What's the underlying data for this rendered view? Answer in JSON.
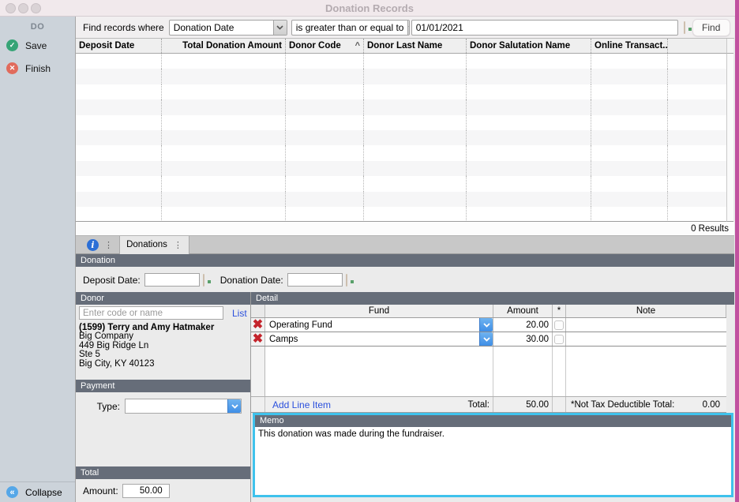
{
  "window": {
    "title": "Donation Records"
  },
  "colors": {
    "section_header": "#666d79",
    "accent_blue": "#3f8ee6",
    "link_blue": "#2b50dd",
    "save_green": "#36a476",
    "finish_red": "#e16b5c",
    "memo_highlight": "#3fc2ec",
    "window_edge_magenta": "#c0519f",
    "sidebar_bg": "#ccd3da"
  },
  "sidebar": {
    "header": "DO",
    "save_label": "Save",
    "finish_label": "Finish",
    "collapse_label": "Collapse"
  },
  "search": {
    "label": "Find records where",
    "field_selected": "Donation Date",
    "operator_selected": "is greater than or equal to",
    "value": "01/01/2021",
    "find_button": "Find"
  },
  "results_table": {
    "columns": [
      "Deposit Date",
      "Total Donation Amount",
      "Donor Code",
      "Donor Last Name",
      "Donor Salutation Name",
      "Online Transact..."
    ],
    "sorted_column": "Donor Code",
    "sort_indicator": "^",
    "empty_row_count": 11,
    "results_text": "0 Results"
  },
  "tabs": {
    "active_tab": "Donations"
  },
  "donation": {
    "section_title": "Donation",
    "deposit_date_label": "Deposit Date:",
    "deposit_date_value": "",
    "donation_date_label": "Donation Date:",
    "donation_date_value": ""
  },
  "donor": {
    "section_title": "Donor",
    "search_placeholder": "Enter code or name",
    "list_link": "List",
    "name": "(1599) Terry and Amy Hatmaker",
    "address_lines": [
      "Big Company",
      "449 Big Ridge Ln",
      "Ste 5",
      "Big City, KY  40123"
    ]
  },
  "payment": {
    "section_title": "Payment",
    "type_label": "Type:",
    "type_value": ""
  },
  "total": {
    "section_title": "Total",
    "amount_label": "Amount:",
    "amount_value": "50.00"
  },
  "detail": {
    "section_title": "Detail",
    "columns": {
      "fund": "Fund",
      "amount": "Amount",
      "star": "*",
      "note": "Note"
    },
    "rows": [
      {
        "fund": "Operating Fund",
        "amount": "20.00",
        "not_tax_deductible": false,
        "note": ""
      },
      {
        "fund": "Camps",
        "amount": "30.00",
        "not_tax_deductible": false,
        "note": ""
      }
    ],
    "add_line_item_link": "Add Line Item",
    "total_label": "Total:",
    "total_value": "50.00",
    "ntd_label": "*Not Tax Deductible Total:",
    "ntd_value": "0.00"
  },
  "memo": {
    "section_title": "Memo",
    "text": "This donation was made during the fundraiser."
  }
}
